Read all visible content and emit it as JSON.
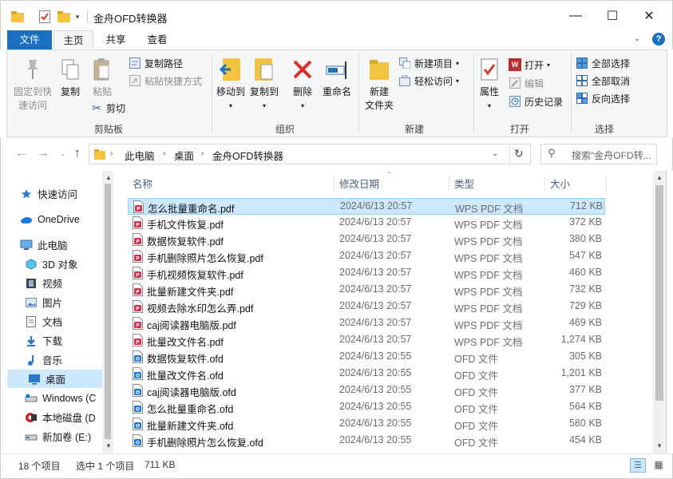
{
  "window": {
    "title": "金舟OFD转换器",
    "controls": {
      "minimize": "—",
      "maximize": "☐",
      "close": "✕"
    }
  },
  "ribbon_tabs": {
    "file": "文件",
    "home": "主页",
    "share": "共享",
    "view": "查看"
  },
  "ribbon": {
    "clipboard": {
      "pin_label_1": "固定到快",
      "pin_label_2": "速访问",
      "copy": "复制",
      "paste": "粘贴",
      "copy_path": "复制路径",
      "paste_shortcut": "粘贴快捷方式",
      "cut": "剪切",
      "group": "剪贴板"
    },
    "organize": {
      "move_to": "移动到",
      "copy_to": "复制到",
      "delete": "删除",
      "rename": "重命名",
      "group": "组织"
    },
    "new": {
      "new_folder_1": "新建",
      "new_folder_2": "文件夹",
      "new_item": "新建项目",
      "easy_access": "轻松访问",
      "group": "新建"
    },
    "open": {
      "properties": "属性",
      "open": "打开",
      "edit": "编辑",
      "history": "历史记录",
      "group": "打开"
    },
    "select": {
      "select_all": "全部选择",
      "select_none": "全部取消",
      "invert": "反向选择",
      "group": "选择"
    }
  },
  "address": {
    "crumbs": [
      "此电脑",
      "桌面",
      "金舟OFD转换器"
    ],
    "search_placeholder": "搜索\"金舟OFD转..."
  },
  "nav": [
    {
      "label": "快速访问",
      "icon": "star-icon"
    },
    {
      "label": "OneDrive",
      "icon": "cloud-icon"
    },
    {
      "label": "此电脑",
      "icon": "computer-icon"
    },
    {
      "label": "3D 对象",
      "icon": "cube-icon"
    },
    {
      "label": "视频",
      "icon": "video-icon"
    },
    {
      "label": "图片",
      "icon": "picture-icon"
    },
    {
      "label": "文档",
      "icon": "document-icon"
    },
    {
      "label": "下载",
      "icon": "download-icon"
    },
    {
      "label": "音乐",
      "icon": "music-icon"
    },
    {
      "label": "桌面",
      "icon": "desktop-icon"
    },
    {
      "label": "Windows (C",
      "icon": "drive-icon"
    },
    {
      "label": "本地磁盘 (D",
      "icon": "drive-icon"
    },
    {
      "label": "新加卷 (E:)",
      "icon": "drive-icon"
    }
  ],
  "columns": {
    "name": "名称",
    "date": "修改日期",
    "type": "类型",
    "size": "大小"
  },
  "files": [
    {
      "name": "怎么批量重命名.pdf",
      "date": "2024/6/13 20:57",
      "type": "WPS PDF 文档",
      "size": "712 KB",
      "kind": "pdf"
    },
    {
      "name": "手机文件恢复.pdf",
      "date": "2024/6/13 20:57",
      "type": "WPS PDF 文档",
      "size": "372 KB",
      "kind": "pdf"
    },
    {
      "name": "数据恢复软件.pdf",
      "date": "2024/6/13 20:57",
      "type": "WPS PDF 文档",
      "size": "380 KB",
      "kind": "pdf"
    },
    {
      "name": "手机删除照片怎么恢复.pdf",
      "date": "2024/6/13 20:57",
      "type": "WPS PDF 文档",
      "size": "547 KB",
      "kind": "pdf"
    },
    {
      "name": "手机视频恢复软件.pdf",
      "date": "2024/6/13 20:57",
      "type": "WPS PDF 文档",
      "size": "460 KB",
      "kind": "pdf"
    },
    {
      "name": "批量新建文件夹.pdf",
      "date": "2024/6/13 20:57",
      "type": "WPS PDF 文档",
      "size": "732 KB",
      "kind": "pdf"
    },
    {
      "name": "视频去除水印怎么弄.pdf",
      "date": "2024/6/13 20:57",
      "type": "WPS PDF 文档",
      "size": "729 KB",
      "kind": "pdf"
    },
    {
      "name": "caj阅读器电脑版.pdf",
      "date": "2024/6/13 20:57",
      "type": "WPS PDF 文档",
      "size": "469 KB",
      "kind": "pdf"
    },
    {
      "name": "批量改文件名.pdf",
      "date": "2024/6/13 20:57",
      "type": "WPS PDF 文档",
      "size": "1,274 KB",
      "kind": "pdf"
    },
    {
      "name": "数据恢复软件.ofd",
      "date": "2024/6/13 20:55",
      "type": "OFD 文件",
      "size": "305 KB",
      "kind": "ofd"
    },
    {
      "name": "批量改文件名.ofd",
      "date": "2024/6/13 20:55",
      "type": "OFD 文件",
      "size": "1,201 KB",
      "kind": "ofd"
    },
    {
      "name": "caj阅读器电脑版.ofd",
      "date": "2024/6/13 20:55",
      "type": "OFD 文件",
      "size": "377 KB",
      "kind": "ofd"
    },
    {
      "name": "怎么批量重命名.ofd",
      "date": "2024/6/13 20:55",
      "type": "OFD 文件",
      "size": "564 KB",
      "kind": "ofd"
    },
    {
      "name": "批量新建文件夹.ofd",
      "date": "2024/6/13 20:55",
      "type": "OFD 文件",
      "size": "580 KB",
      "kind": "ofd"
    },
    {
      "name": "手机删除照片怎么恢复.ofd",
      "date": "2024/6/13 20:55",
      "type": "OFD 文件",
      "size": "454 KB",
      "kind": "ofd"
    }
  ],
  "status": {
    "count": "18 个项目",
    "selected": "选中 1 个项目",
    "size": "711 KB"
  },
  "colors": {
    "accent": "#1a6fc2",
    "selection": "#cce8ff",
    "pdf_icon": "#d9304a",
    "ofd_icon": "#1e7ad6"
  }
}
